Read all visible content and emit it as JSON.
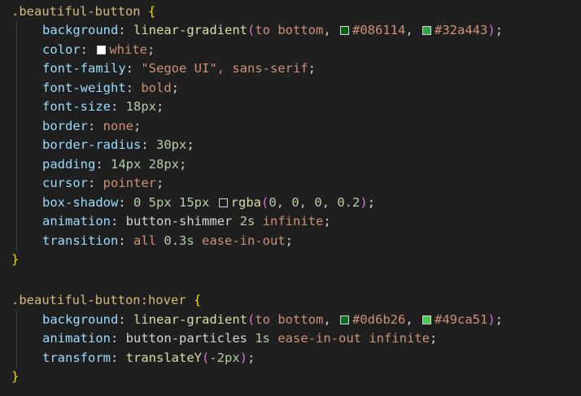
{
  "editor": {
    "rule1": {
      "selector": ".beautiful-button",
      "decls": [
        {
          "prop": "background",
          "fn": "linear-gradient",
          "dir": "to bottom",
          "c1": "#086114",
          "c2": "#32a443"
        },
        {
          "prop": "color",
          "value": "white",
          "swatch": "#ffffff"
        },
        {
          "prop": "font-family",
          "value": "\"Segoe UI\", sans-serif"
        },
        {
          "prop": "font-weight",
          "value": "bold"
        },
        {
          "prop": "font-size",
          "value": "18px"
        },
        {
          "prop": "border",
          "value": "none"
        },
        {
          "prop": "border-radius",
          "value": "30px"
        },
        {
          "prop": "padding",
          "value": "14px 28px"
        },
        {
          "prop": "cursor",
          "value": "pointer"
        },
        {
          "prop": "box-shadow",
          "prefix": "0 5px 15px",
          "fn": "rgba",
          "args": "0, 0, 0, 0.2",
          "swatch": "rgba(0,0,0,0.2)"
        },
        {
          "prop": "animation",
          "name": "button-shimmer",
          "dur": "2s",
          "iter": "infinite"
        },
        {
          "prop": "transition",
          "p": "all",
          "dur": "0.3s",
          "easing": "ease-in-out"
        }
      ]
    },
    "rule2": {
      "selector": ".beautiful-button:hover",
      "decls": [
        {
          "prop": "background",
          "fn": "linear-gradient",
          "dir": "to bottom",
          "c1": "#0d6b26",
          "c2": "#49ca51"
        },
        {
          "prop": "animation",
          "name": "button-particles",
          "dur": "1s",
          "easing": "ease-in-out",
          "iter": "infinite"
        },
        {
          "prop": "transform",
          "fn": "translateY",
          "arg": "-2px"
        }
      ]
    },
    "tokens": {
      "open_brace": "{",
      "close_brace": "}",
      "colon": ": ",
      "semicolon": ";",
      "comma": ", ",
      "lparen": "(",
      "rparen": ")"
    }
  }
}
